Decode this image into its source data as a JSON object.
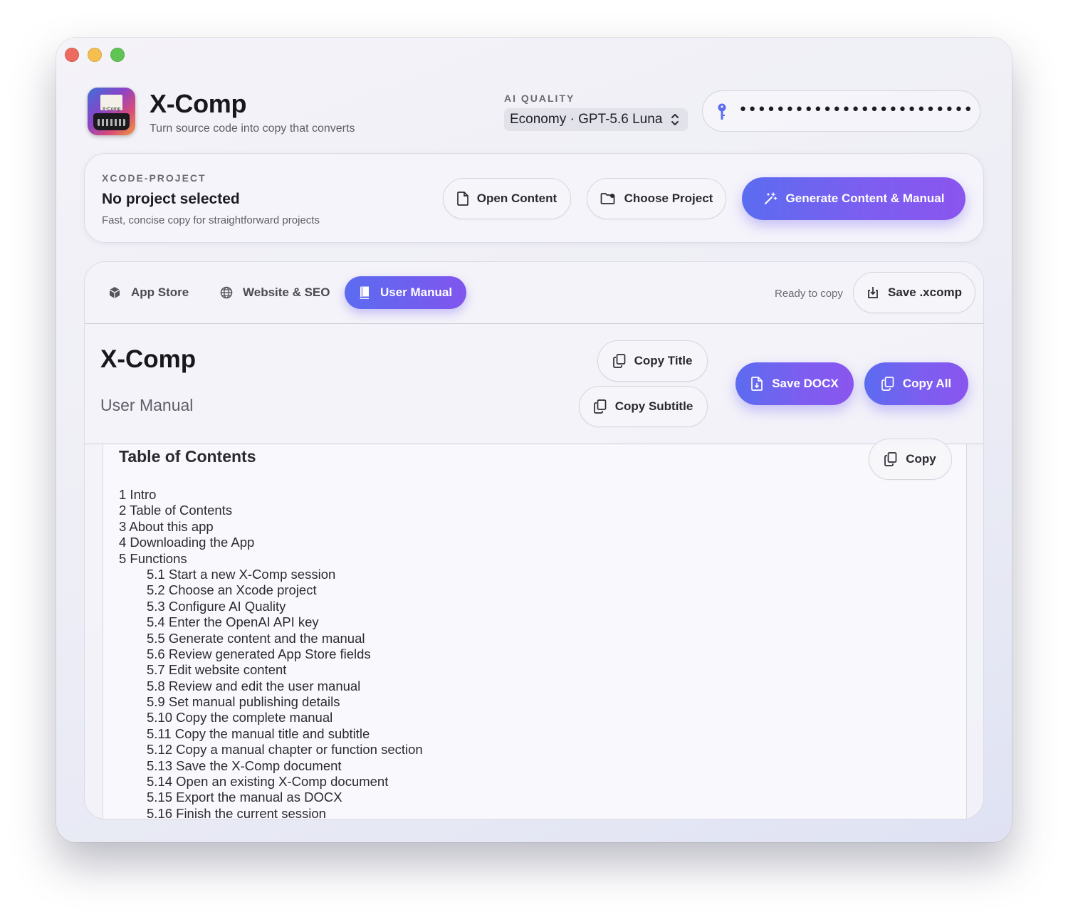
{
  "app": {
    "title": "X-Comp",
    "subtitle": "Turn source code into copy that converts",
    "icon_label": "X-Comp"
  },
  "ai_quality": {
    "label": "AI QUALITY",
    "selected": "Economy · GPT-5.6 Luna"
  },
  "api_key": {
    "masked_value": "••••••••••••••••••••••••••••"
  },
  "project": {
    "label": "XCODE-PROJECT",
    "title": "No project selected",
    "description": "Fast, concise copy for straightforward projects",
    "open_content": "Open Content",
    "choose_project": "Choose Project",
    "generate": "Generate Content & Manual"
  },
  "tabs": [
    {
      "label": "App Store",
      "icon": "cube-icon"
    },
    {
      "label": "Website & SEO",
      "icon": "globe-icon"
    },
    {
      "label": "User Manual",
      "icon": "book-icon",
      "active": true
    }
  ],
  "status": {
    "ready_text": "Ready to copy",
    "save_xcomp": "Save .xcomp"
  },
  "manual": {
    "title": "X-Comp",
    "subtitle": "User Manual",
    "copy_title": "Copy Title",
    "copy_subtitle": "Copy Subtitle",
    "save_docx": "Save DOCX",
    "copy_all": "Copy All"
  },
  "toc": {
    "title": "Table of Contents",
    "copy": "Copy",
    "items": [
      {
        "text": "1 Intro",
        "level": 1
      },
      {
        "text": "2 Table of Contents",
        "level": 1
      },
      {
        "text": "3 About this app",
        "level": 1
      },
      {
        "text": "4 Downloading the App",
        "level": 1
      },
      {
        "text": "5 Functions",
        "level": 1
      },
      {
        "text": "5.1 Start a new X-Comp session",
        "level": 2
      },
      {
        "text": "5.2 Choose an Xcode project",
        "level": 2
      },
      {
        "text": "5.3 Configure AI Quality",
        "level": 2
      },
      {
        "text": "5.4 Enter the OpenAI API key",
        "level": 2
      },
      {
        "text": "5.5 Generate content and the manual",
        "level": 2
      },
      {
        "text": "5.6 Review generated App Store fields",
        "level": 2
      },
      {
        "text": "5.7 Edit website content",
        "level": 2
      },
      {
        "text": "5.8 Review and edit the user manual",
        "level": 2
      },
      {
        "text": "5.9 Set manual publishing details",
        "level": 2
      },
      {
        "text": "5.10 Copy the complete manual",
        "level": 2
      },
      {
        "text": "5.11 Copy the manual title and subtitle",
        "level": 2
      },
      {
        "text": "5.12 Copy a manual chapter or function section",
        "level": 2
      },
      {
        "text": "5.13 Save the X-Comp document",
        "level": 2
      },
      {
        "text": "5.14 Open an existing X-Comp document",
        "level": 2
      },
      {
        "text": "5.15 Export the manual as DOCX",
        "level": 2
      },
      {
        "text": "5.16 Finish the current session",
        "level": 2
      }
    ]
  },
  "colors": {
    "accent_start": "#5b6cf0",
    "accent_end": "#8a55ee",
    "traffic_red": "#ec6a5e",
    "traffic_yellow": "#f4bf4f",
    "traffic_green": "#61c554"
  }
}
